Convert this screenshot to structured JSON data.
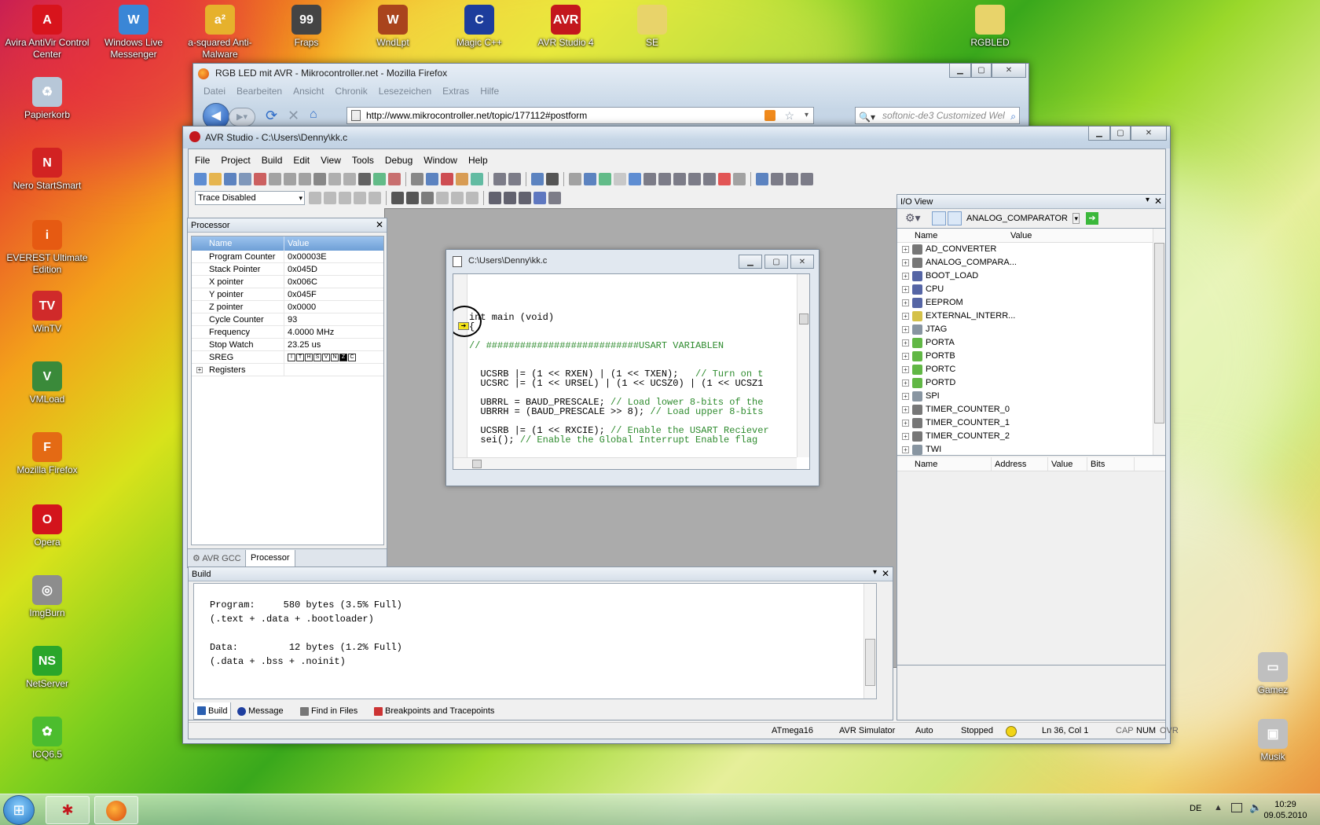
{
  "desktop": {
    "icons": [
      {
        "label": "Avira AntiVir Control Center",
        "color": "#d8141c",
        "glyph": "A"
      },
      {
        "label": "Windows Live Messenger",
        "color": "#3a86d6",
        "glyph": "W"
      },
      {
        "label": "a-squared Anti-Malware",
        "color": "#e6b12c",
        "glyph": "a²"
      },
      {
        "label": "Fraps",
        "color": "#444444",
        "glyph": "99"
      },
      {
        "label": "WndLpt",
        "color": "#a9441d",
        "glyph": "W"
      },
      {
        "label": "Magic C++",
        "color": "#1d3d9c",
        "glyph": "C"
      },
      {
        "label": "AVR Studio 4",
        "color": "#c3171d",
        "glyph": "AVR"
      },
      {
        "label": "SE",
        "color": "#e8d36a",
        "glyph": ""
      },
      {
        "label": "RGBLED",
        "color": "#e8d36a",
        "glyph": ""
      },
      {
        "label": "Papierkorb",
        "color": "#b7c7d8",
        "glyph": "♻"
      },
      {
        "label": "Nero StartSmart",
        "color": "#d22222",
        "glyph": "N"
      },
      {
        "label": "EVEREST Ultimate Edition",
        "color": "#e65a12",
        "glyph": "i"
      },
      {
        "label": "WinTV",
        "color": "#d02a2a",
        "glyph": "TV"
      },
      {
        "label": "VMLoad",
        "color": "#3a8a3a",
        "glyph": "V"
      },
      {
        "label": "Mozilla Firefox",
        "color": "#e46a14",
        "glyph": "F"
      },
      {
        "label": "Opera",
        "color": "#d3141c",
        "glyph": "O"
      },
      {
        "label": "ImgBurn",
        "color": "#8d8d8d",
        "glyph": "◎"
      },
      {
        "label": "NetServer",
        "color": "#2aa62a",
        "glyph": "NS"
      },
      {
        "label": "ICQ6.5",
        "color": "#4cbd2e",
        "glyph": "✿"
      },
      {
        "label": "Gamez",
        "color": "#bfbfbf",
        "glyph": "▭"
      },
      {
        "label": "Musik",
        "color": "#bfbfbf",
        "glyph": "▣"
      }
    ]
  },
  "firefox": {
    "title": "RGB LED mit AVR - Mikrocontroller.net - Mozilla Firefox",
    "menu": [
      "Datei",
      "Bearbeiten",
      "Ansicht",
      "Chronik",
      "Lesezeichen",
      "Extras",
      "Hilfe"
    ],
    "url": "http://www.mikrocontroller.net/topic/177112#postform",
    "search_placeholder": "softonic-de3 Customized Wel"
  },
  "avr": {
    "title": "AVR Studio - C:\\Users\\Denny\\kk.c",
    "menu": [
      "File",
      "Project",
      "Build",
      "Edit",
      "View",
      "Tools",
      "Debug",
      "Window",
      "Help"
    ],
    "trace_select": "Trace Disabled",
    "processor": {
      "title": "Processor",
      "col_name": "Name",
      "col_value": "Value",
      "rows": [
        {
          "name": "Program Counter",
          "value": "0x00003E"
        },
        {
          "name": "Stack Pointer",
          "value": "0x045D"
        },
        {
          "name": "X pointer",
          "value": "0x006C"
        },
        {
          "name": "Y pointer",
          "value": "0x045F"
        },
        {
          "name": "Z pointer",
          "value": "0x0000"
        },
        {
          "name": "Cycle Counter",
          "value": "93"
        },
        {
          "name": "Frequency",
          "value": "4.0000 MHz"
        },
        {
          "name": "Stop Watch",
          "value": "23.25 us"
        },
        {
          "name": "SREG",
          "value": ""
        },
        {
          "name": "Registers",
          "value": ""
        }
      ],
      "sreg_bits": [
        "I",
        "T",
        "H",
        "S",
        "V",
        "N",
        "Z",
        "C"
      ],
      "tabs": [
        "AVR GCC",
        "Processor"
      ]
    },
    "editor": {
      "title": "C:\\Users\\Denny\\kk.c",
      "lines": [
        {
          "code": "int main (void)",
          "comment": ""
        },
        {
          "code": "{",
          "comment": ""
        },
        {
          "code": "",
          "comment": "// ###########################USART VARIABLEN"
        },
        {
          "code": "",
          "comment": ""
        },
        {
          "code": "  UCSRB |= (1 << RXEN) | (1 << TXEN);   ",
          "comment": "// Turn on t"
        },
        {
          "code": "  UCSRC |= (1 << URSEL) | (1 << UCSZ0) | (1 << UCSZ1",
          "comment": ""
        },
        {
          "code": "",
          "comment": ""
        },
        {
          "code": "  UBRRL = BAUD_PRESCALE; ",
          "comment": "// Load lower 8-bits of the"
        },
        {
          "code": "  UBRRH = (BAUD_PRESCALE >> 8); ",
          "comment": "// Load upper 8-bits"
        },
        {
          "code": "",
          "comment": ""
        },
        {
          "code": "  UCSRB |= (1 << RXCIE); ",
          "comment": "// Enable the USART Reciever"
        },
        {
          "code": "  sei(); ",
          "comment": "// Enable the Global Interrupt Enable flag"
        }
      ]
    },
    "io_view": {
      "title": "I/O View",
      "device_select": "ANALOG_COMPARATOR",
      "col_name": "Name",
      "col_value": "Value",
      "items": [
        {
          "label": "AD_CONVERTER",
          "icon": "#555555"
        },
        {
          "label": "ANALOG_COMPARA...",
          "icon": "#555555"
        },
        {
          "label": "BOOT_LOAD",
          "icon": "#2b3f8f"
        },
        {
          "label": "CPU",
          "icon": "#2b3f8f"
        },
        {
          "label": "EEPROM",
          "icon": "#2b3f8f"
        },
        {
          "label": "EXTERNAL_INTERR...",
          "icon": "#c9b21b"
        },
        {
          "label": "JTAG",
          "icon": "#6a7a8a"
        },
        {
          "label": "PORTA",
          "icon": "#3aa516"
        },
        {
          "label": "PORTB",
          "icon": "#3aa516"
        },
        {
          "label": "PORTC",
          "icon": "#3aa516"
        },
        {
          "label": "PORTD",
          "icon": "#3aa516"
        },
        {
          "label": "SPI",
          "icon": "#6a7a8a"
        },
        {
          "label": "TIMER_COUNTER_0",
          "icon": "#555555"
        },
        {
          "label": "TIMER_COUNTER_1",
          "icon": "#555555"
        },
        {
          "label": "TIMER_COUNTER_2",
          "icon": "#555555"
        },
        {
          "label": "TWI",
          "icon": "#6a7a8a"
        }
      ],
      "detail_cols": [
        "Name",
        "Address",
        "Value",
        "Bits"
      ]
    },
    "build": {
      "title": "Build",
      "output": [
        "Program:     580 bytes (3.5% Full)",
        "(.text + .data + .bootloader)",
        "",
        "Data:         12 bytes (1.2% Full)",
        "(.data + .bss + .noinit)"
      ],
      "tabs": [
        "Build",
        "Message",
        "Find in Files",
        "Breakpoints and Tracepoints"
      ]
    },
    "status": {
      "device": "ATmega16",
      "platform": "AVR Simulator",
      "mode": "Auto",
      "state": "Stopped",
      "position": "Ln 36, Col 1",
      "cap": "CAP",
      "num": "NUM",
      "ovr": "OVR"
    }
  },
  "taskbar": {
    "lang": "DE",
    "time": "10:29",
    "date": "09.05.2010"
  }
}
